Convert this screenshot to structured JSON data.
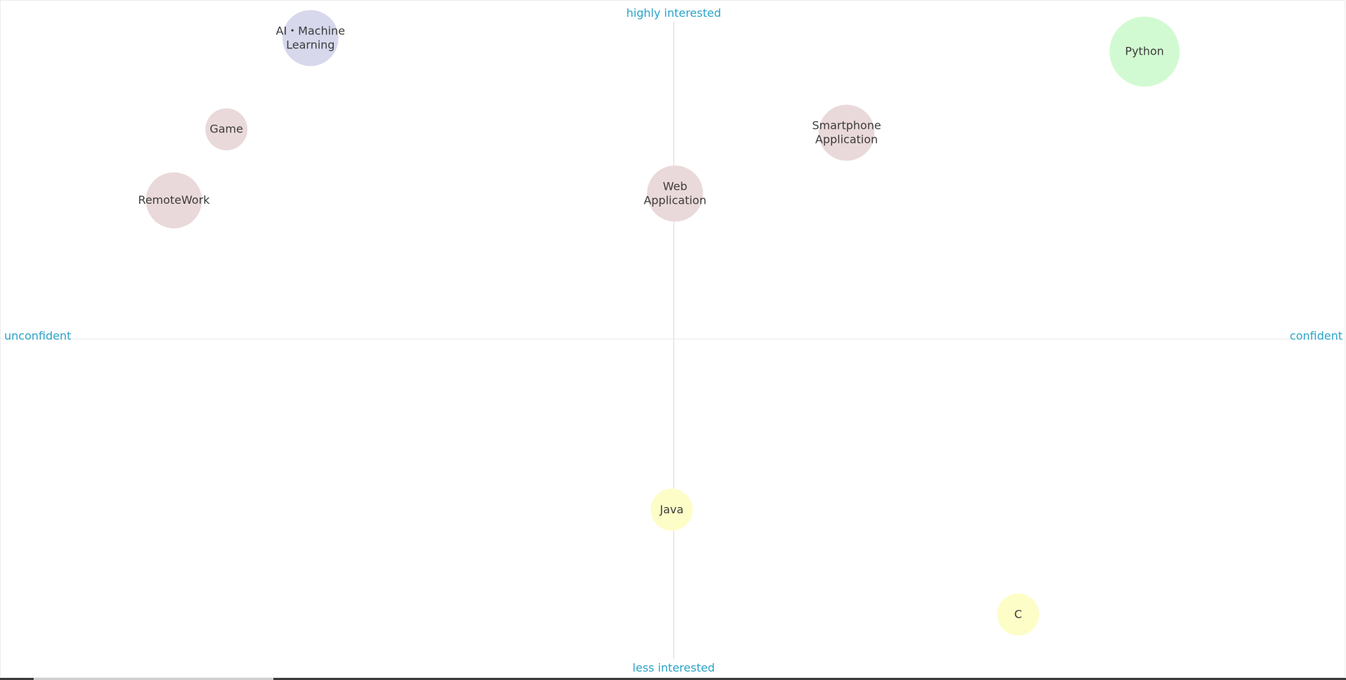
{
  "chart_data": {
    "type": "scatter",
    "title": "",
    "axis_labels": {
      "top": "highly interested",
      "bottom": "less interested",
      "left": "unconfident",
      "right": "confident"
    },
    "xlabel": "confident",
    "ylabel": "highly interested",
    "xlim": [
      -1,
      1
    ],
    "ylim": [
      -1,
      1
    ],
    "grid": false,
    "points": [
      {
        "label": [
          "AI・Machine",
          "Learning"
        ],
        "x": -0.54,
        "y": 0.89,
        "size": 0.8,
        "color": "#d7d8ec"
      },
      {
        "label": [
          "Python"
        ],
        "x": 0.7,
        "y": 0.85,
        "size": 1.0,
        "color": "#d2fad2"
      },
      {
        "label": [
          "Game"
        ],
        "x": -0.665,
        "y": 0.62,
        "size": 0.6,
        "color": "#ead9da"
      },
      {
        "label": [
          "Smartphone",
          "Application"
        ],
        "x": 0.257,
        "y": 0.61,
        "size": 0.8,
        "color": "#ead9da"
      },
      {
        "label": [
          "RemoteWork"
        ],
        "x": -0.743,
        "y": 0.41,
        "size": 0.8,
        "color": "#ead9da"
      },
      {
        "label": [
          "Web",
          "Application"
        ],
        "x": 0.002,
        "y": 0.43,
        "size": 0.8,
        "color": "#ead9da"
      },
      {
        "label": [
          "Java"
        ],
        "x": -0.003,
        "y": -0.505,
        "size": 0.6,
        "color": "#fdfdc8"
      },
      {
        "label": [
          "C"
        ],
        "x": 0.512,
        "y": -0.815,
        "size": 0.6,
        "color": "#fdfdc8"
      }
    ]
  }
}
